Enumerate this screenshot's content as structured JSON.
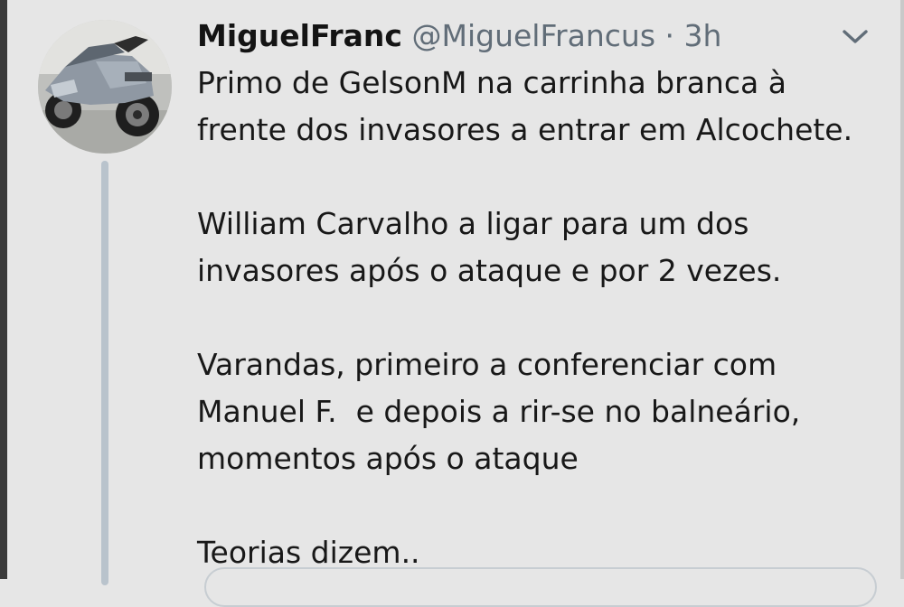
{
  "tweet": {
    "author": {
      "display_name": "MiguelFranc",
      "handle": "@MiguelFrancus",
      "separator": "·",
      "time": "3h",
      "avatar_icon": "motorcycle-avatar"
    },
    "menu_icon": "chevron-down-icon",
    "body_lines": [
      "Primo de GelsonM na carrinha branca à",
      "frente dos invasores a entrar em Alcochete.",
      "",
      "William Carvalho a ligar para um dos",
      "invasores após o ataque e por 2 vezes.",
      "",
      "Varandas, primeiro a conferenciar com",
      "Manuel F.  e depois a rir-se no balneário,",
      "momentos após o ataque",
      "",
      "Teorias dizem.."
    ]
  },
  "colors": {
    "background": "#e6e6e6",
    "text": "#181818",
    "secondary_text": "#616d78",
    "thread_line": "#b9c3cc"
  }
}
